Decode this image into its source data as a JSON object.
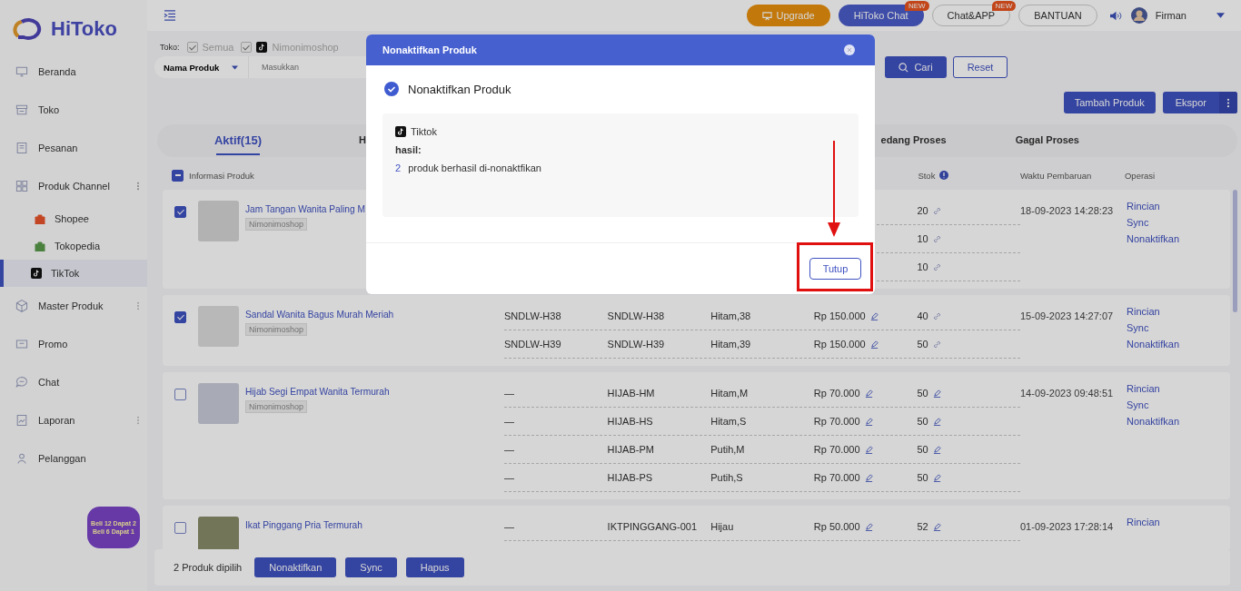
{
  "brand": {
    "name": "HiToko"
  },
  "sidebar": {
    "items": [
      {
        "label": "Beranda",
        "kind": "link"
      },
      {
        "label": "Toko",
        "kind": "link"
      },
      {
        "label": "Pesanan",
        "kind": "link"
      },
      {
        "label": "Produk Channel",
        "kind": "group",
        "expanded": true,
        "children": [
          {
            "label": "Shopee",
            "kind": "orange-bag",
            "selected": false
          },
          {
            "label": "Tokopedia",
            "kind": "green-bag",
            "selected": false
          },
          {
            "label": "TikTok",
            "kind": "tiktok",
            "selected": true
          }
        ]
      },
      {
        "label": "Master Produk",
        "kind": "group",
        "expanded": false
      },
      {
        "label": "Promo",
        "kind": "link"
      },
      {
        "label": "Chat",
        "kind": "link"
      },
      {
        "label": "Laporan",
        "kind": "group",
        "expanded": false
      },
      {
        "label": "Pelanggan",
        "kind": "link"
      }
    ]
  },
  "promo_badge": {
    "lines": [
      "Beli 12 Dapat 2",
      "Beli 6 Dapat 1"
    ]
  },
  "topbar": {
    "buttons": [
      {
        "label": "Upgrade",
        "kind": "upgrade"
      },
      {
        "label": "HiToko Chat",
        "kind": "primary",
        "badge": "NEW"
      },
      {
        "label": "Chat&APP",
        "kind": "outline",
        "badge": "NEW"
      },
      {
        "label": "BANTUAN",
        "kind": "outline"
      }
    ],
    "user": "Firman"
  },
  "filter": {
    "store_label": "Toko:",
    "stores": [
      {
        "label": "Semua",
        "checked": true,
        "kind": "plain"
      },
      {
        "label": "Nimonimoshop",
        "checked": true,
        "kind": "tiktok"
      }
    ],
    "field_select": "Nama Produk",
    "placeholder": "Masukkan",
    "search_button": "Cari",
    "reset_button": "Reset"
  },
  "actions": [
    "Tambah Produk",
    "Ekspor"
  ],
  "tabs": [
    {
      "label": "Aktif(15)",
      "selected": true
    },
    {
      "label": "H",
      "selected": false
    },
    {
      "label": "edang Proses",
      "selected": false
    },
    {
      "label": "Gagal Proses",
      "selected": false
    }
  ],
  "table": {
    "indeterminate": true,
    "columns": [
      "Informasi Produk",
      "Stok",
      "Waktu Pembaruan",
      "Operasi"
    ],
    "rows": [
      {
        "title": "Jam Tangan Wanita Paling M",
        "shop": "Nimonimoshop",
        "checked": true,
        "updated": "18-09-2023 14:28:23",
        "operations": [
          "Rincian",
          "Sync",
          "Nonaktifkan"
        ],
        "variants": [
          {
            "stock": "20",
            "kind": "link"
          },
          {
            "stock": "10",
            "kind": "link"
          },
          {
            "stock": "10",
            "kind": "link"
          }
        ]
      },
      {
        "title": "Sandal Wanita Bagus Murah Meriah",
        "shop": "Nimonimoshop",
        "checked": true,
        "updated": "15-09-2023 14:27:07",
        "operations": [
          "Rincian",
          "Sync",
          "Nonaktifkan"
        ],
        "variants": [
          {
            "cells": [
              "SNDLW-H38",
              "SNDLW-H38",
              "Hitam,38",
              "Rp 150.000"
            ],
            "stock": "40",
            "kind": "link"
          },
          {
            "cells": [
              "SNDLW-H39",
              "SNDLW-H39",
              "Hitam,39",
              "Rp 150.000"
            ],
            "stock": "50",
            "kind": "link"
          }
        ]
      },
      {
        "title": "Hijab Segi Empat Wanita Termurah",
        "shop": "Nimonimoshop",
        "checked": false,
        "updated": "14-09-2023 09:48:51",
        "operations": [
          "Rincian",
          "Sync",
          "Nonaktifkan"
        ],
        "variants": [
          {
            "cells": [
              "—",
              "HIJAB-HM",
              "Hitam,M",
              "Rp 70.000"
            ],
            "stock": "50",
            "kind": "edit"
          },
          {
            "cells": [
              "—",
              "HIJAB-HS",
              "Hitam,S",
              "Rp 70.000"
            ],
            "stock": "50",
            "kind": "edit"
          },
          {
            "cells": [
              "—",
              "HIJAB-PM",
              "Putih,M",
              "Rp 70.000"
            ],
            "stock": "50",
            "kind": "edit"
          },
          {
            "cells": [
              "—",
              "HIJAB-PS",
              "Putih,S",
              "Rp 70.000"
            ],
            "stock": "50",
            "kind": "edit"
          }
        ]
      },
      {
        "title": "Ikat Pinggang Pria Termurah",
        "checked": false,
        "updated": "01-09-2023 17:28:14",
        "operations": [
          "Rincian"
        ],
        "variants": [
          {
            "cells": [
              "—",
              "IKTPINGGANG-001",
              "Hijau",
              "Rp 50.000"
            ],
            "stock": "52",
            "kind": "edit"
          }
        ]
      }
    ]
  },
  "bulk_bar": {
    "count_text": "2 Produk dipilih",
    "buttons": [
      "Nonaktifkan",
      "Sync",
      "Hapus"
    ]
  },
  "modal": {
    "title": "Nonaktifkan Produk",
    "heading": "Nonaktifkan Produk",
    "platform": "Tiktok",
    "result_label": "hasil:",
    "count": "2",
    "message": "produk berhasil di-nonaktfikan",
    "close_button": "Tutup"
  }
}
